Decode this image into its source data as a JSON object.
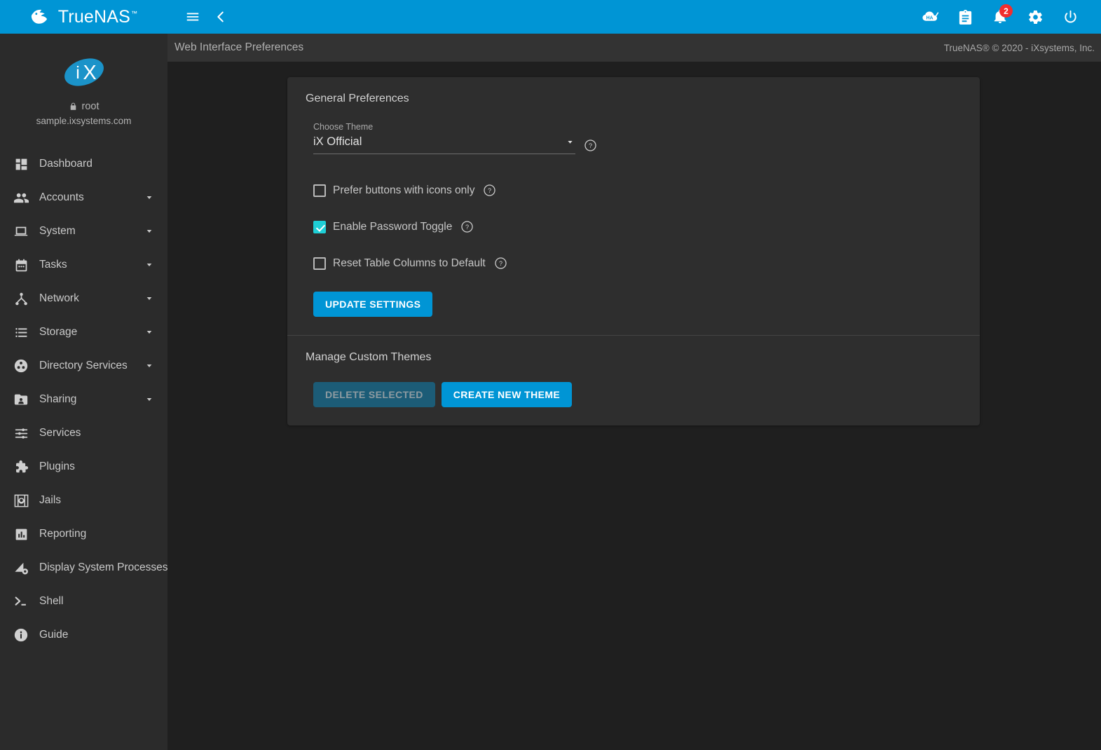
{
  "app": {
    "brand_name": "TrueNAS",
    "brand_tm": "™",
    "logo_icon": "truenas-whale-logo"
  },
  "topbar": {
    "menu_icon": "hamburger-menu-icon",
    "collapse_icon": "chevron-left-icon",
    "icons": [
      {
        "name": "ha-status-icon",
        "label": "HA"
      },
      {
        "name": "task-manager-clipboard-icon",
        "label": ""
      },
      {
        "name": "notifications-bell-icon",
        "label": ""
      },
      {
        "name": "settings-gear-icon",
        "label": ""
      },
      {
        "name": "power-icon",
        "label": ""
      }
    ],
    "notification_count": "2",
    "badge_color": "#f12e2e",
    "bar_color": "#0095d5"
  },
  "sidebar": {
    "logo_icon": "ix-systems-logo",
    "logo_text": "iX",
    "lock_icon": "lock-icon",
    "username": "root",
    "hostname": "sample.ixsystems.com",
    "items": [
      {
        "label": "Dashboard",
        "icon": "dashboard-grid-icon",
        "expandable": false
      },
      {
        "label": "Accounts",
        "icon": "accounts-people-icon",
        "expandable": true
      },
      {
        "label": "System",
        "icon": "system-laptop-icon",
        "expandable": true
      },
      {
        "label": "Tasks",
        "icon": "tasks-calendar-icon",
        "expandable": true
      },
      {
        "label": "Network",
        "icon": "network-nodes-icon",
        "expandable": true
      },
      {
        "label": "Storage",
        "icon": "storage-server-icon",
        "expandable": true
      },
      {
        "label": "Directory Services",
        "icon": "directory-services-icon",
        "expandable": true
      },
      {
        "label": "Sharing",
        "icon": "sharing-folder-icon",
        "expandable": true
      },
      {
        "label": "Services",
        "icon": "services-sliders-icon",
        "expandable": false
      },
      {
        "label": "Plugins",
        "icon": "plugins-puzzle-icon",
        "expandable": false
      },
      {
        "label": "Jails",
        "icon": "jails-icon",
        "expandable": false
      },
      {
        "label": "Reporting",
        "icon": "reporting-chart-icon",
        "expandable": false
      },
      {
        "label": "Display System Processes",
        "icon": "system-processes-icon",
        "expandable": false
      },
      {
        "label": "Shell",
        "icon": "shell-terminal-icon",
        "expandable": false
      },
      {
        "label": "Guide",
        "icon": "guide-info-icon",
        "expandable": false
      }
    ]
  },
  "subbar": {
    "breadcrumb": "Web Interface Preferences",
    "copyright": "TrueNAS® © 2020 - iXsystems, Inc."
  },
  "general_preferences": {
    "title": "General Preferences",
    "theme_field": {
      "label": "Choose Theme",
      "value": "iX Official",
      "dropdown_icon": "chevron-down-icon",
      "help_icon": "help-circle-icon"
    },
    "checkboxes": [
      {
        "label": "Prefer buttons with icons only",
        "checked": false,
        "help_icon": "help-circle-icon"
      },
      {
        "label": "Enable Password Toggle",
        "checked": true,
        "help_icon": "help-circle-icon"
      },
      {
        "label": "Reset Table Columns to Default",
        "checked": false,
        "help_icon": "help-circle-icon"
      }
    ],
    "update_button": "UPDATE SETTINGS"
  },
  "manage_custom_themes": {
    "title": "Manage Custom Themes",
    "delete_button": "DELETE SELECTED",
    "create_button": "CREATE NEW THEME"
  },
  "colors": {
    "accent_blue": "#0095d5",
    "checkbox_teal": "#1ecfd6",
    "page_bg": "#1f1f1f",
    "sidebar_bg": "#2b2b2b",
    "card_bg": "#2e2e2e"
  }
}
